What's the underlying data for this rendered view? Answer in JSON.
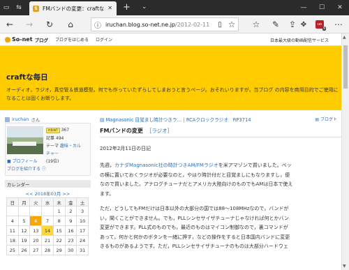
{
  "browser": {
    "tab_title": "FMバンドの変更：craftな",
    "tab_favicon": "S",
    "new_tab": "+",
    "tab_menu": "⌄",
    "url_host": "iruchan.blog.so-net.ne.jp",
    "url_path": "/2012-02-11",
    "ublock_count": "9",
    "ublock_label": "uo"
  },
  "sonet": {
    "logo_text": "So-net",
    "blog_label": "ブログ",
    "link_start": "ブログをはじめる",
    "link_login": "ログイン",
    "tagline": "日本最大級の動画配信サービス"
  },
  "site": {
    "title": "craftな毎日",
    "description": "オーディオ，ラジオ，真空管＆鉄道模型。何でも作っていたずらしてしまおうと言うページ。おそれいりますが，当ブログ の内容を商用目的でご使用になることは固くお断りします。"
  },
  "sidebar": {
    "user": "iruchan",
    "user_suffix": "さん",
    "nice_label": "nice!",
    "nice_count": "367",
    "articles": "記事 494",
    "theme_label": "テーマ",
    "theme_value": "趣味・カル",
    "theme_cont": "チャー",
    "theme_count": "(19位)",
    "profile_link": "プロフィール",
    "intro_link": "ブログを紹介する",
    "calendar_title": "カレンダー",
    "calendar_nav": "<< 2018年03月 >>",
    "calendar": {
      "dow": [
        "日",
        "月",
        "火",
        "水",
        "木",
        "金",
        "土"
      ],
      "weeks": [
        [
          "",
          "",
          "",
          "",
          "1",
          "2",
          "3"
        ],
        [
          "4",
          "5",
          "6",
          "7",
          "8",
          "9",
          "10"
        ],
        [
          "11",
          "12",
          "13",
          "14",
          "15",
          "16",
          "17"
        ],
        [
          "18",
          "19",
          "20",
          "21",
          "22",
          "23",
          "24"
        ],
        [
          "25",
          "26",
          "27",
          "28",
          "29",
          "30",
          "31"
        ]
      ],
      "highlight_orange": "6",
      "highlight_yellow": "14"
    }
  },
  "main": {
    "crumb_prev": "Magnasonic 目覚まし時計つきラ…",
    "crumb_next": "RCAクロックラジオ　RP3714",
    "crumb_right": "ブログト",
    "post_title": "FMバンドの変更",
    "post_category": "［ラジオ］",
    "date": "2012年2月11日の日記",
    "p1": {
      "pre": "先週，",
      "link": "カナダMagnasonic社の時計つきAM/FMラジオ",
      "post": "を米アマゾンで買いました。ベッ",
      "l2": "の横に置いておくラジオが必要なのと，やはり時計付だと目覚ましにもなりますし，便",
      "l3": "なので買いました。アナログチューナだとアメリカ大陸向けのものでもAMは日本で使え",
      "l4": "ます。"
    },
    "p2": {
      "l1": "ただ，どうしてもFMだけは日本以外の大部分の国では88～108MHzなので，バンドが",
      "l2": "い，聞くことができません。でも，PLLシンセサイザチューナじゃなければ何とかバン",
      "l3": "変更ができます。PLL式のものでも，最近のものはマイコン制御なので，裏コマンドが",
      "l4": "あって，何かと何かのボタンを一緒に押す，などの操作をすると日本国内バンドに変更",
      "l5": "きるものがあるようです。ただ，PLLシンセサイザチューナのものは大部分ハードウェ"
    }
  }
}
